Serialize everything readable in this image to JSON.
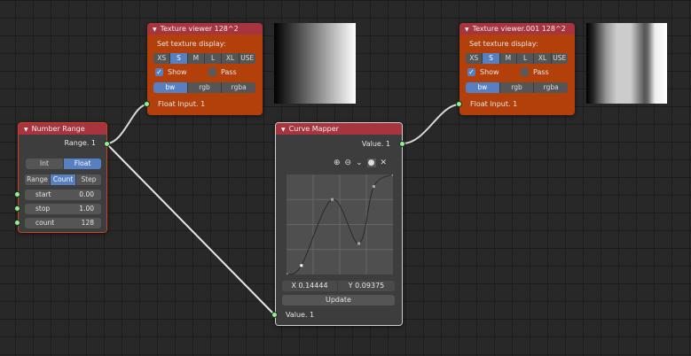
{
  "texture_viewer_1": {
    "title": "Texture viewer 128^2",
    "set_display_label": "Set texture display:",
    "sizes": [
      "XS",
      "S",
      "M",
      "L",
      "XL",
      "USE"
    ],
    "selected_size": "S",
    "show_label": "Show",
    "show_checked": true,
    "pass_label": "Pass",
    "pass_checked": false,
    "modes": [
      "bw",
      "rgb",
      "rgba"
    ],
    "selected_mode": "bw",
    "input_label": "Float Input. 1"
  },
  "texture_viewer_2": {
    "title": "Texture viewer.001 128^2",
    "set_display_label": "Set texture display:",
    "sizes": [
      "XS",
      "S",
      "M",
      "L",
      "XL",
      "USE"
    ],
    "selected_size": "S",
    "show_label": "Show",
    "show_checked": true,
    "pass_label": "Pass",
    "pass_checked": false,
    "modes": [
      "bw",
      "rgb",
      "rgba"
    ],
    "selected_mode": "bw",
    "input_label": "Float Input. 1"
  },
  "number_range": {
    "title": "Number Range",
    "output_label": "Range. 1",
    "types": [
      "Int",
      "Float"
    ],
    "selected_type": "Float",
    "modes": [
      "Range",
      "Count",
      "Step"
    ],
    "selected_mode": "Count",
    "fields": [
      {
        "label": "start",
        "value": "0.00"
      },
      {
        "label": "stop",
        "value": "1.00"
      },
      {
        "label": "count",
        "value": "128"
      }
    ]
  },
  "curve_mapper": {
    "title": "Curve Mapper",
    "output_label": "Value. 1",
    "input_label": "Value. 1",
    "x_readout": "X 0.14444",
    "y_readout": "Y 0.09375",
    "update_label": "Update",
    "curve_points": [
      [
        0,
        0
      ],
      [
        0.14,
        0.09
      ],
      [
        0.43,
        0.75
      ],
      [
        0.68,
        0.31
      ],
      [
        0.82,
        0.88
      ],
      [
        1,
        1
      ]
    ],
    "selected_point": 1
  },
  "colors": {
    "node_header": "#a7353f",
    "texture_node_body": "#b33f0b",
    "selected_button": "#5680c2",
    "socket": "#8ef08e"
  }
}
